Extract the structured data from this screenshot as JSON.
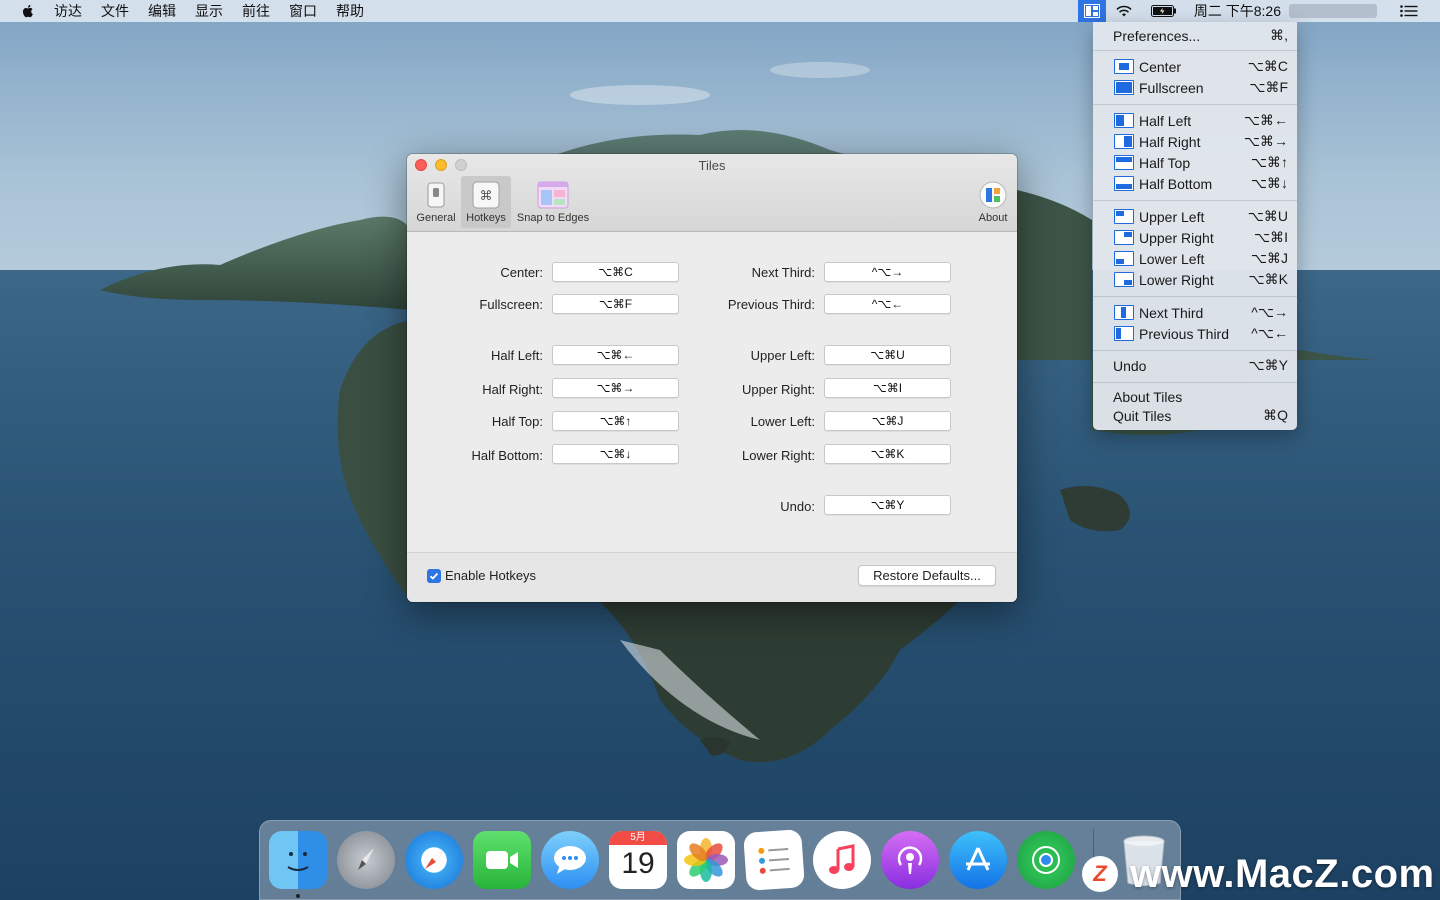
{
  "menubar": {
    "items": [
      "访达",
      "文件",
      "编辑",
      "显示",
      "前往",
      "窗口",
      "帮助"
    ],
    "clock": "周二 下午8:26"
  },
  "dropdown": {
    "preferences": {
      "label": "Preferences...",
      "shortcut": "⌘,"
    },
    "center": {
      "label": "Center",
      "shortcut": "⌥⌘C"
    },
    "fullscreen": {
      "label": "Fullscreen",
      "shortcut": "⌥⌘F"
    },
    "half_left": {
      "label": "Half Left",
      "shortcut": "⌥⌘←"
    },
    "half_right": {
      "label": "Half Right",
      "shortcut": "⌥⌘→"
    },
    "half_top": {
      "label": "Half Top",
      "shortcut": "⌥⌘↑"
    },
    "half_bottom": {
      "label": "Half Bottom",
      "shortcut": "⌥⌘↓"
    },
    "upper_left": {
      "label": "Upper Left",
      "shortcut": "⌥⌘U"
    },
    "upper_right": {
      "label": "Upper Right",
      "shortcut": "⌥⌘I"
    },
    "lower_left": {
      "label": "Lower Left",
      "shortcut": "⌥⌘J"
    },
    "lower_right": {
      "label": "Lower Right",
      "shortcut": "⌥⌘K"
    },
    "next_third": {
      "label": "Next Third",
      "shortcut": "^⌥→"
    },
    "previous_third": {
      "label": "Previous Third",
      "shortcut": "^⌥←"
    },
    "undo": {
      "label": "Undo",
      "shortcut": "⌥⌘Y"
    },
    "about": {
      "label": "About Tiles"
    },
    "quit": {
      "label": "Quit Tiles",
      "shortcut": "⌘Q"
    }
  },
  "window": {
    "title": "Tiles",
    "tabs": {
      "general": "General",
      "hotkeys": "Hotkeys",
      "snap": "Snap to Edges",
      "about": "About"
    },
    "hotkeys": {
      "center": {
        "label": "Center:",
        "value": "⌥⌘C"
      },
      "fullscreen": {
        "label": "Fullscreen:",
        "value": "⌥⌘F"
      },
      "half_left": {
        "label": "Half Left:",
        "value": "⌥⌘←"
      },
      "half_right": {
        "label": "Half Right:",
        "value": "⌥⌘→"
      },
      "half_top": {
        "label": "Half Top:",
        "value": "⌥⌘↑"
      },
      "half_bottom": {
        "label": "Half Bottom:",
        "value": "⌥⌘↓"
      },
      "next_third": {
        "label": "Next Third:",
        "value": "^⌥→"
      },
      "previous_third": {
        "label": "Previous Third:",
        "value": "^⌥←"
      },
      "upper_left": {
        "label": "Upper Left:",
        "value": "⌥⌘U"
      },
      "upper_right": {
        "label": "Upper Right:",
        "value": "⌥⌘I"
      },
      "lower_left": {
        "label": "Lower Left:",
        "value": "⌥⌘J"
      },
      "lower_right": {
        "label": "Lower Right:",
        "value": "⌥⌘K"
      },
      "undo": {
        "label": "Undo:",
        "value": "⌥⌘Y"
      }
    },
    "enable_hotkeys": {
      "label": "Enable Hotkeys",
      "checked": true
    },
    "restore_defaults": "Restore Defaults..."
  },
  "dock": {
    "apps": [
      "finder-icon",
      "launchpad-icon",
      "safari-icon",
      "facetime-icon",
      "messages-icon",
      "calendar-icon",
      "photos-icon",
      "reminders-icon",
      "music-icon",
      "podcasts-icon",
      "app-store-icon",
      "find-my-icon",
      "trash-icon"
    ],
    "calendar": {
      "month": "5月",
      "day": "19"
    }
  },
  "watermark": {
    "text": "www.MacZ.com",
    "badge": "Z"
  },
  "colors": {
    "accent": "#2f74e3",
    "close": "#fc5f57",
    "minimize": "#fdbc2e"
  }
}
